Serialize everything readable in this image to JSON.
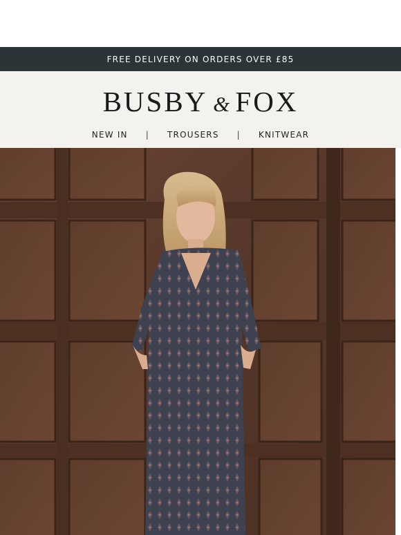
{
  "promo": {
    "text": "FREE DELIVERY ON ORDERS OVER £85"
  },
  "brand": {
    "name_part1": "BUSBY",
    "ampersand": "&",
    "name_part2": "FOX"
  },
  "nav": {
    "items": [
      {
        "label": "NEW IN"
      },
      {
        "label": "TROUSERS"
      },
      {
        "label": "KNITWEAR"
      }
    ],
    "separator": "|"
  },
  "hero": {
    "alt": "Model in dark floral print maxi dress against wood panelled wall"
  },
  "colors": {
    "promo_bg": "#2b3436",
    "header_bg": "#f4f2ee",
    "wood": "#5a3a28"
  }
}
